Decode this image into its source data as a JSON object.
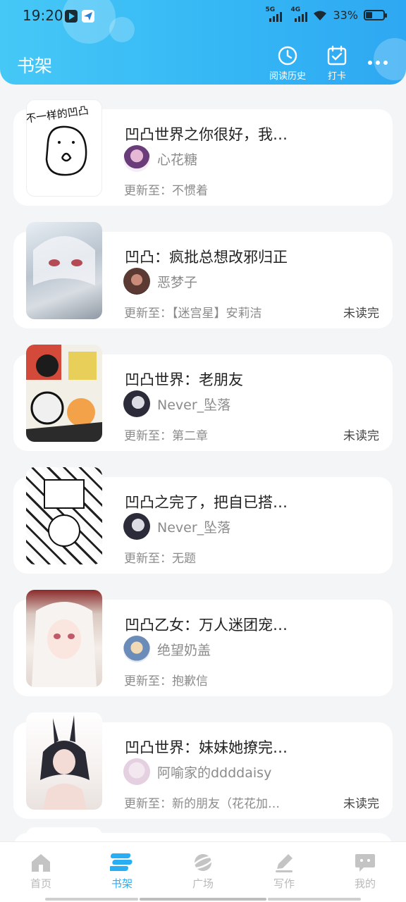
{
  "status_bar": {
    "time": "19:20",
    "net1": "5G",
    "net2": "4G",
    "battery": "33%",
    "battery_level": 0.33
  },
  "header": {
    "title": "书架",
    "history_label": "阅读历史",
    "checkin_label": "打卡",
    "accent": "#35b7f5"
  },
  "books": [
    {
      "title": "凹凸世界之你很好，我…",
      "author": "心花糖",
      "update_prefix": "更新至：",
      "update": "不惯着",
      "status": "",
      "cover_text": "不一样的凹凸"
    },
    {
      "title": "凹凸：疯批总想改邪归正",
      "author": "恶梦子",
      "update_prefix": "更新至：",
      "update": "【迷宫星】安莉洁",
      "status": "未读完"
    },
    {
      "title": "凹凸世界：老朋友",
      "author": "Never_坠落",
      "update_prefix": "更新至：",
      "update": "第二章",
      "status": "未读完"
    },
    {
      "title": "凹凸之完了，把自已搭…",
      "author": "Never_坠落",
      "update_prefix": "更新至：",
      "update": "无题",
      "status": ""
    },
    {
      "title": "凹凸乙女：万人迷团宠…",
      "author": "绝望奶盖",
      "update_prefix": "更新至：",
      "update": "抱歉信",
      "status": ""
    },
    {
      "title": "凹凸世界：妹妹她撩完…",
      "author": "阿喻家的ddddaisy",
      "update_prefix": "更新至：",
      "update": "新的朋友（花花加…",
      "status": "未读完"
    }
  ],
  "tabs": [
    {
      "label": "首页",
      "icon": "home-icon"
    },
    {
      "label": "书架",
      "icon": "bookshelf-icon",
      "active": true
    },
    {
      "label": "广场",
      "icon": "planet-icon"
    },
    {
      "label": "写作",
      "icon": "pen-icon"
    },
    {
      "label": "我的",
      "icon": "chat-bubble-icon"
    }
  ]
}
